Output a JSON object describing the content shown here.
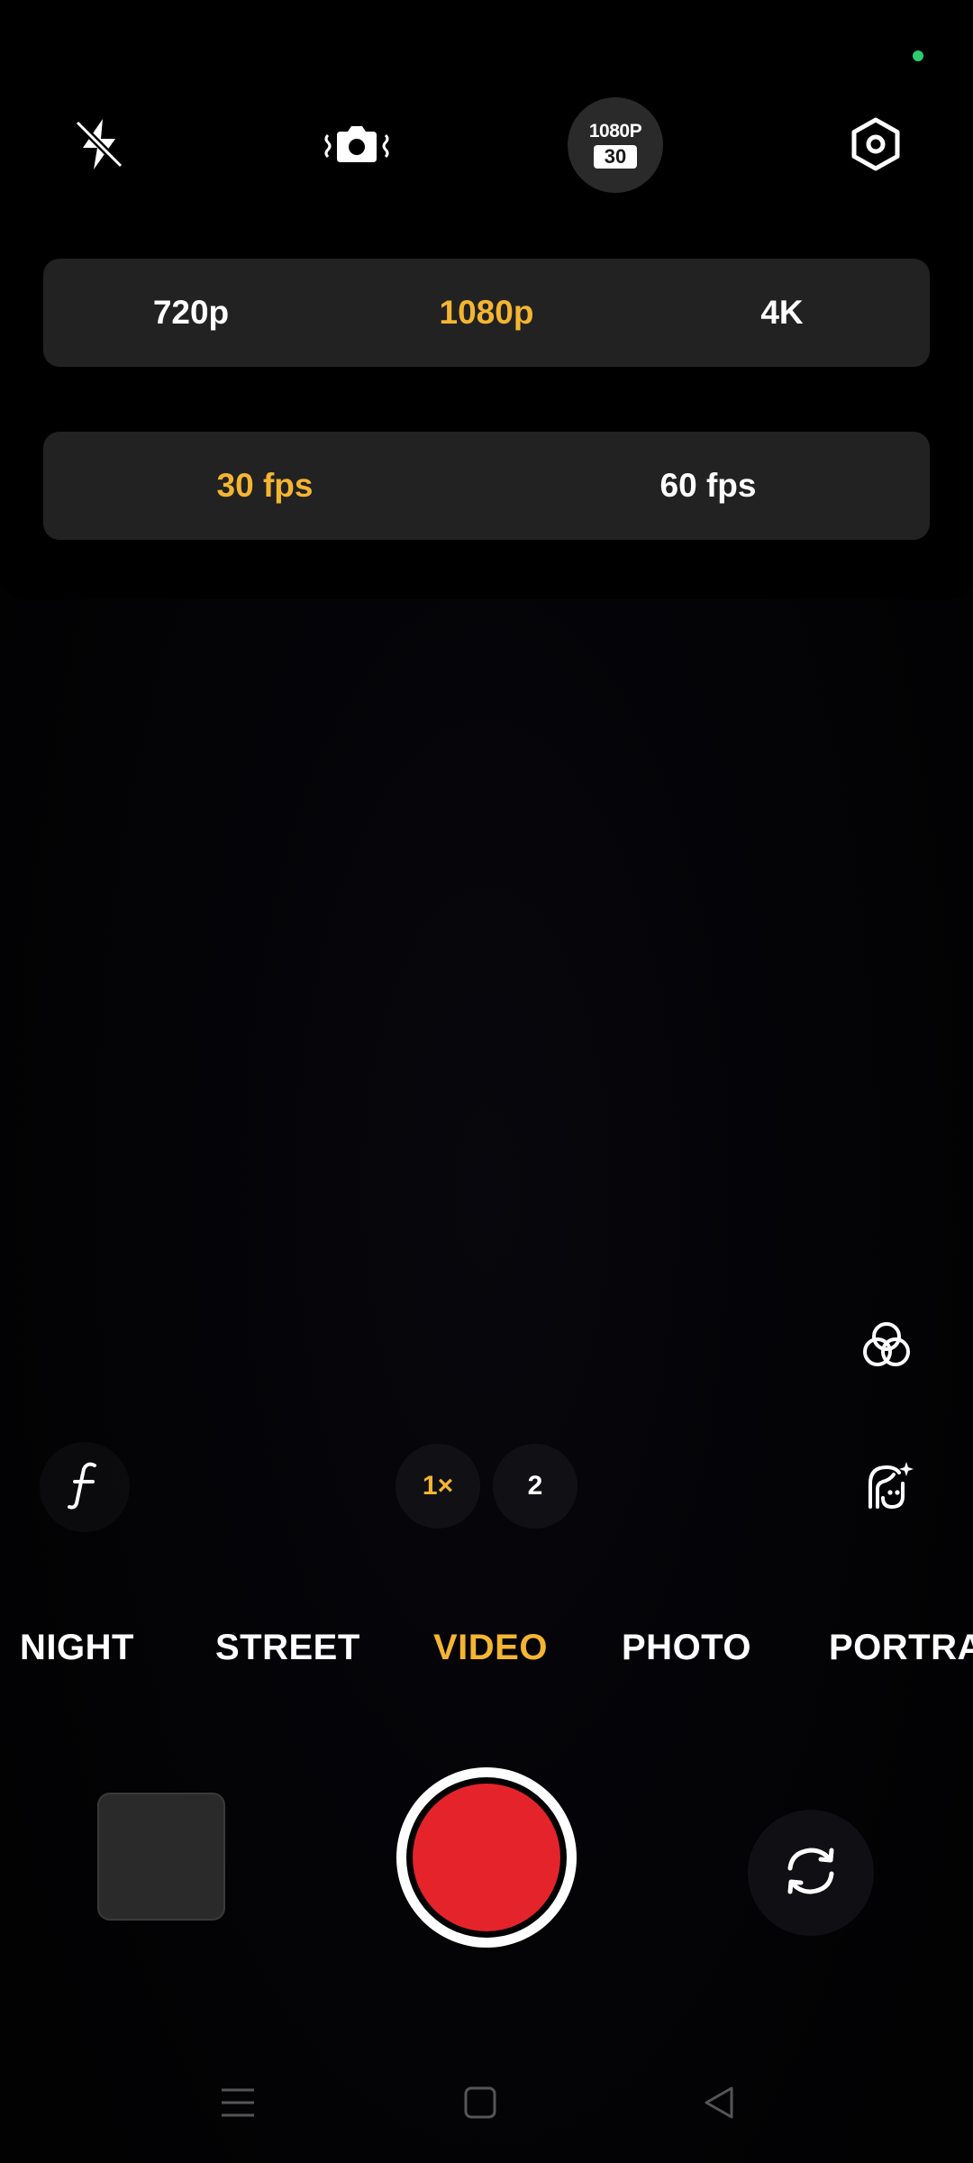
{
  "colors": {
    "accent": "#f5b531",
    "record": "#e5232a",
    "panel": "#222222",
    "status_dot": "#2ecc71"
  },
  "top_bar": {
    "flash_icon": "flash-off-icon",
    "stabilization_icon": "stabilization-icon",
    "resolution_badge": {
      "top": "1080P",
      "bottom": "30"
    },
    "settings_icon": "settings-hexagon-icon"
  },
  "resolution_options": [
    "720p",
    "1080p",
    "4K"
  ],
  "resolution_selected": "1080p",
  "fps_options": [
    "30 fps",
    "60 fps"
  ],
  "fps_selected": "30 fps",
  "controls": {
    "filter_icon": "filter-circles-icon",
    "pro_icon": "f-script-icon",
    "beauty_icon": "beauty-face-icon",
    "zoom_levels": [
      "1×",
      "2"
    ],
    "zoom_selected": "1×"
  },
  "modes": [
    "NIGHT",
    "STREET",
    "VIDEO",
    "PHOTO",
    "PORTRAIT"
  ],
  "mode_selected": "VIDEO",
  "bottom": {
    "gallery_icon": "gallery-thumbnail",
    "record_icon": "record-button",
    "flip_icon": "camera-flip-icon"
  },
  "nav": {
    "menu_icon": "menu-icon",
    "home_icon": "home-square-icon",
    "back_icon": "back-triangle-icon"
  }
}
